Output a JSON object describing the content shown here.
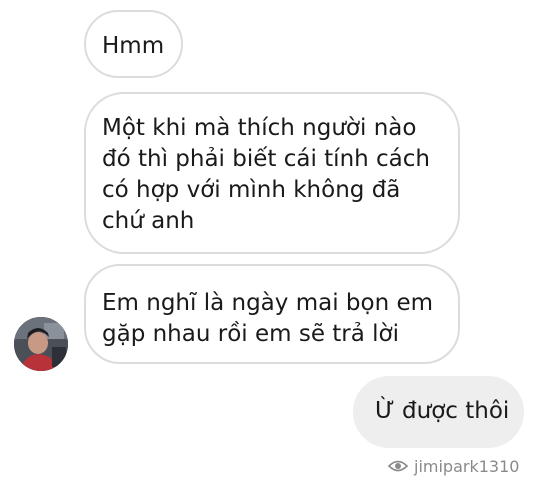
{
  "messages": [
    {
      "id": "msg1",
      "direction": "incoming",
      "text": "Hmm"
    },
    {
      "id": "msg2",
      "direction": "incoming",
      "text": "Một khi mà thích người nào\nđó thì phải biết cái tính cách\ncó hợp với mình không đã\nchứ anh"
    },
    {
      "id": "msg3",
      "direction": "incoming",
      "text": "Em nghĩ là ngày mai bọn em\ngặp nhau rồi em sẽ trả lời"
    },
    {
      "id": "msg4",
      "direction": "outgoing",
      "text": "Ừ được thôi"
    }
  ],
  "watermark": {
    "icon": "eye-icon",
    "text": "jimipark1310"
  },
  "colors": {
    "incoming_bubble": "#ffffff",
    "incoming_border": "#dcdcdc",
    "outgoing_bubble": "#eeeeee",
    "text": "#1a1a1a",
    "watermark": "#8a8a8a"
  }
}
